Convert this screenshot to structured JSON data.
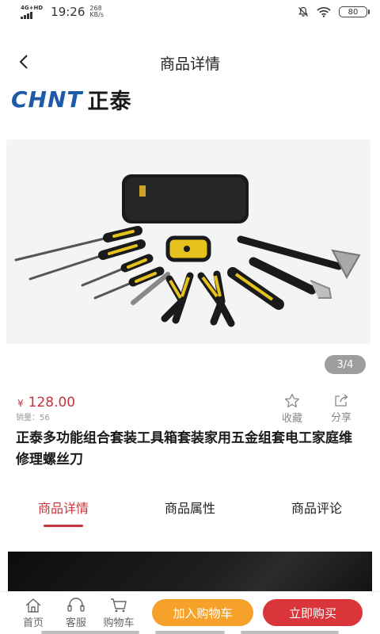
{
  "status_bar": {
    "network": "4G+HD",
    "time": "19:26",
    "speed_value": "268",
    "speed_unit": "KB/s",
    "battery": "80"
  },
  "header": {
    "title": "商品详情"
  },
  "brand": {
    "logo_en": "CHNT",
    "logo_cn": "正泰"
  },
  "product": {
    "image_indicator": "3/4",
    "currency": "¥",
    "price": "128.00",
    "sales": "销量：56",
    "title": "正泰多功能组合套装工具箱套装家用五金组套电工家庭维修理螺丝刀",
    "favorite_label": "收藏",
    "share_label": "分享"
  },
  "tabs": [
    {
      "label": "商品详情",
      "active": true
    },
    {
      "label": "商品属性",
      "active": false
    },
    {
      "label": "商品评论",
      "active": false
    }
  ],
  "bottom_bar": {
    "home_label": "首页",
    "service_label": "客服",
    "cart_label": "购物车",
    "add_cart_button": "加入购物车",
    "buy_now_button": "立即购买"
  },
  "colors": {
    "accent": "#c8323a",
    "cart_button": "#f5a12a",
    "buy_button": "#d9353b",
    "brand_blue": "#1d5aa8"
  }
}
